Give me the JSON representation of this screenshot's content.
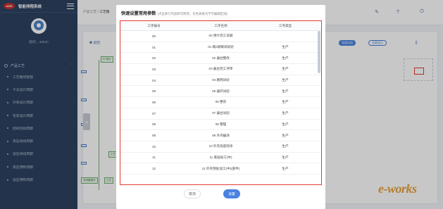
{
  "sidebar": {
    "logo_text": "AMS",
    "brand": "智能排程系统",
    "user": "超好，admin",
    "group": "产品工艺",
    "items": [
      {
        "label": "工艺路线管理"
      },
      {
        "label": "干法设计周期"
      },
      {
        "label": "外壳设计周期"
      },
      {
        "label": "包装设计周期"
      },
      {
        "label": "控线包线周期"
      },
      {
        "label": "高压线线周期"
      },
      {
        "label": "低压线线周期"
      },
      {
        "label": "高压预制周期"
      },
      {
        "label": "低压预制周期"
      }
    ]
  },
  "header": {
    "crumb_root": "产品工艺",
    "crumb_sep": " / ",
    "crumb_current": "工艺路"
  },
  "canvas": {
    "back": "返回",
    "layout_btn": "局部自由",
    "fullscreen_btn": "全屏显示",
    "collapse": "»",
    "nodes": [
      "01 预计",
      "工艺",
      "工艺",
      "工艺",
      "工艺",
      "工艺",
      "变电器操作",
      "工艺"
    ]
  },
  "modal": {
    "title": "快速设置常用参数",
    "hint": "(点击某行内容即可修改，灰色表格为不可编辑区域)",
    "columns": [
      "工序编号",
      "工序名称",
      "工序类型"
    ],
    "rows": [
      [
        "00",
        "00 预计完工日期",
        ""
      ],
      [
        "01",
        "01 箱2级联调试验",
        "生产"
      ],
      [
        "02",
        "02 器台整改",
        "生产"
      ],
      [
        "03",
        "03 器台完工评审",
        "生产"
      ],
      [
        "04",
        "04 路而试验",
        "生产"
      ],
      [
        "05",
        "05 器开试验",
        "生产"
      ],
      [
        "06",
        "06 整装",
        "生产"
      ],
      [
        "07",
        "07 器台试验",
        "生产"
      ],
      [
        "08",
        "08 整理",
        "生产"
      ],
      [
        "09",
        "09 外壳编涂",
        "生产"
      ],
      [
        "10",
        "10 外壳高度喷涂",
        "生产"
      ],
      [
        "11",
        "11 底层加工(中)",
        "生产"
      ],
      [
        "12",
        "12 外壳预处加工(中)(部件)",
        "生产"
      ]
    ],
    "cancel": "取消",
    "confirm": "设置"
  },
  "watermark": "e-works",
  "colors": {
    "sidebar": "#2d4262",
    "accent": "#4a82e0",
    "highlight": "#e33b33"
  }
}
